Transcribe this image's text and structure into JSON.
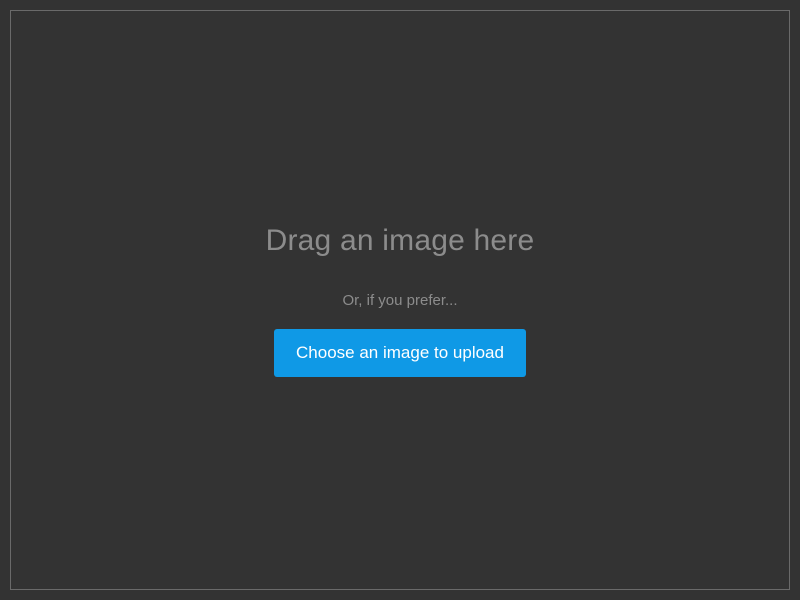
{
  "dropzone": {
    "drag_heading": "Drag an image here",
    "or_text": "Or, if you prefer...",
    "choose_button_label": "Choose an image to upload"
  },
  "colors": {
    "background": "#333333",
    "border": "#6a6a6a",
    "muted_text": "#8c8c8c",
    "button_bg": "#0f99e6",
    "button_text": "#ffffff"
  }
}
